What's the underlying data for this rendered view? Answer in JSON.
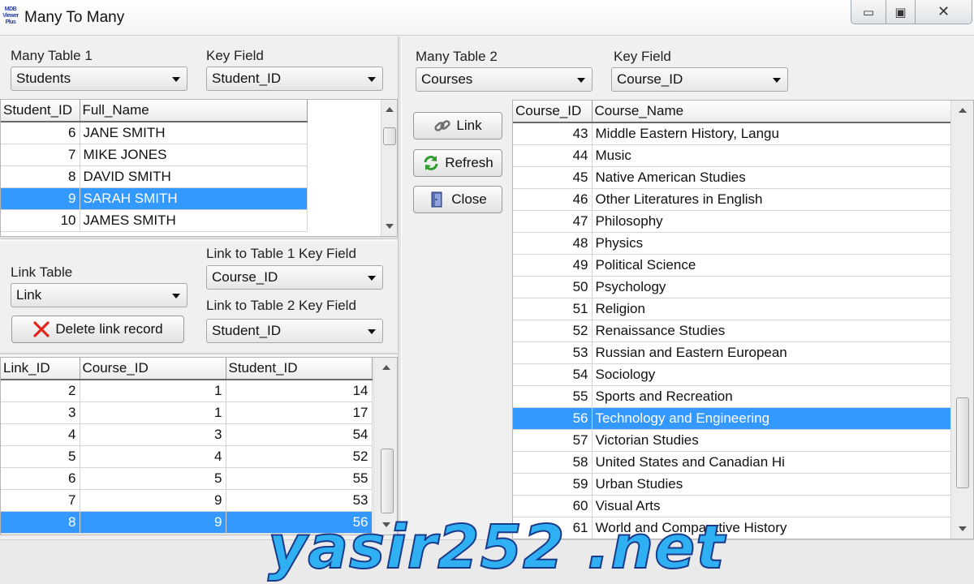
{
  "window": {
    "title": "Many To Many",
    "icon_text": [
      "MDB",
      "Viewer",
      "Plus"
    ],
    "controls": {
      "minimize": "▭",
      "maximize": "▣",
      "close": "✕"
    }
  },
  "left": {
    "table1_label": "Many Table 1",
    "table1_value": "Students",
    "key1_label": "Key Field",
    "key1_value": "Student_ID",
    "students": {
      "columns": [
        "Student_ID",
        "Full_Name"
      ],
      "rows": [
        {
          "id": "6",
          "name": "JANE SMITH"
        },
        {
          "id": "7",
          "name": "MIKE JONES"
        },
        {
          "id": "8",
          "name": "DAVID SMITH"
        },
        {
          "id": "9",
          "name": "SARAH SMITH"
        },
        {
          "id": "10",
          "name": "JAMES SMITH"
        }
      ],
      "selected_index": 3
    },
    "link_table_label": "Link Table",
    "link_table_value": "Link",
    "link_to_t1_label": "Link to Table 1 Key Field",
    "link_to_t1_value": "Course_ID",
    "link_to_t2_label": "Link to Table 2 Key Field",
    "link_to_t2_value": "Student_ID",
    "delete_button": "Delete link record",
    "links": {
      "columns": [
        "Link_ID",
        "Course_ID",
        "Student_ID"
      ],
      "rows": [
        [
          "2",
          "1",
          "14"
        ],
        [
          "3",
          "1",
          "17"
        ],
        [
          "4",
          "3",
          "54"
        ],
        [
          "5",
          "4",
          "52"
        ],
        [
          "6",
          "5",
          "55"
        ],
        [
          "7",
          "9",
          "53"
        ],
        [
          "8",
          "9",
          "56"
        ]
      ],
      "selected_index": 6
    }
  },
  "right": {
    "table2_label": "Many Table 2",
    "table2_value": "Courses",
    "key2_label": "Key Field",
    "key2_value": "Course_ID",
    "buttons": {
      "link": "Link",
      "refresh": "Refresh",
      "close": "Close"
    },
    "courses": {
      "columns": [
        "Course_ID",
        "Course_Name"
      ],
      "rows": [
        [
          "43",
          "Middle Eastern History, Langu"
        ],
        [
          "44",
          "Music"
        ],
        [
          "45",
          "Native American Studies"
        ],
        [
          "46",
          "Other Literatures in English"
        ],
        [
          "47",
          "Philosophy"
        ],
        [
          "48",
          "Physics"
        ],
        [
          "49",
          "Political Science"
        ],
        [
          "50",
          "Psychology"
        ],
        [
          "51",
          "Religion"
        ],
        [
          "52",
          "Renaissance Studies"
        ],
        [
          "53",
          "Russian and Eastern European"
        ],
        [
          "54",
          "Sociology"
        ],
        [
          "55",
          "Sports and Recreation"
        ],
        [
          "56",
          "Technology and Engineering"
        ],
        [
          "57",
          "Victorian Studies"
        ],
        [
          "58",
          "United States and Canadian Hi"
        ],
        [
          "59",
          "Urban Studies"
        ],
        [
          "60",
          "Visual Arts"
        ],
        [
          "61",
          "World and Comparative History"
        ]
      ],
      "selected_index": 13
    }
  },
  "watermark": "yasir252 .net",
  "colors": {
    "selection": "#3399ff",
    "watermark_fill": "#2fb0f2",
    "watermark_stroke": "#1a3a8a"
  }
}
